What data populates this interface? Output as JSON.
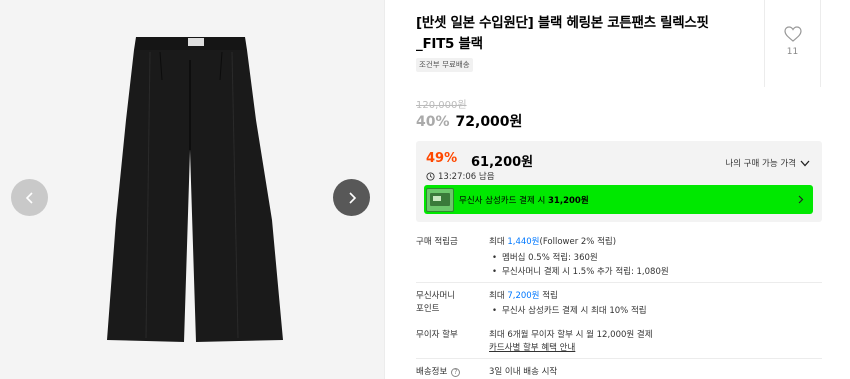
{
  "product": {
    "title": "[반셋 일본 수입원단] 블랙 헤링본 코튼팬츠 릴렉스핏_FIT5 블랙",
    "tag": "조건부 무료배송",
    "like_count": "11"
  },
  "price": {
    "original": "120,000원",
    "discount_rate": "40%",
    "sale_price": "72,000원"
  },
  "member_price": {
    "rate": "49%",
    "price": "61,200원",
    "link_label": "나의 구매 가능 가격",
    "timer": "13:27:06 남음",
    "card_text_prefix": "무신사 삼성카드 결제 시 ",
    "card_text_price": "31,200원"
  },
  "points": {
    "label": "구매 적립금",
    "prefix": "최대 ",
    "amount": "1,440원",
    "suffix": "(Follower 2% 적립)",
    "bullets": [
      "멤버십 0.5% 적립: 360원",
      "무신사머니 결제 시 1.5% 추가 적립: 1,080원"
    ]
  },
  "musinsa_points": {
    "label_line1": "무신사머니",
    "label_line2": "포인트",
    "prefix": "최대 ",
    "amount": "7,200원",
    "suffix": " 적립",
    "bullets": [
      "무신사 삼성카드 결제 시 최대 10% 적립"
    ]
  },
  "installment": {
    "label": "무이자 할부",
    "value": "최대 6개월 무이자 할부 시 월 12,000원 결제",
    "link": "카드사별 할부 혜택 안내"
  },
  "shipping": {
    "label": "배송정보",
    "help_icon": "?",
    "value": "3일 이내 배송 시작"
  },
  "colors": {
    "accent_orange": "#ff4800",
    "link_blue": "#0078ff",
    "banner_green": "#00e800"
  }
}
